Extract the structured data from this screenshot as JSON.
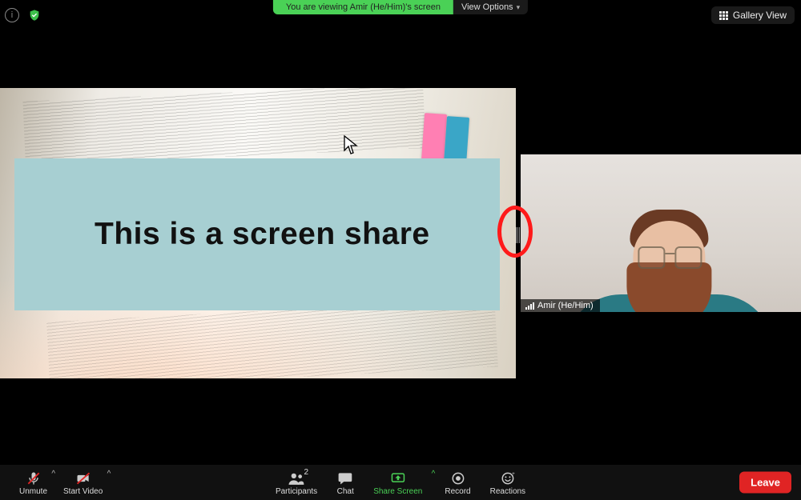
{
  "top": {
    "share_banner": "You are viewing Amir (He/Him)'s screen",
    "view_options_label": "View Options",
    "gallery_view_label": "Gallery View"
  },
  "share": {
    "banner_text": "This is a screen share"
  },
  "video": {
    "participant_name": "Amir (He/Him)"
  },
  "toolbar": {
    "unmute": "Unmute",
    "start_video": "Start Video",
    "participants": "Participants",
    "participants_count": "2",
    "chat": "Chat",
    "share_screen": "Share Screen",
    "record": "Record",
    "reactions": "Reactions",
    "leave": "Leave"
  }
}
